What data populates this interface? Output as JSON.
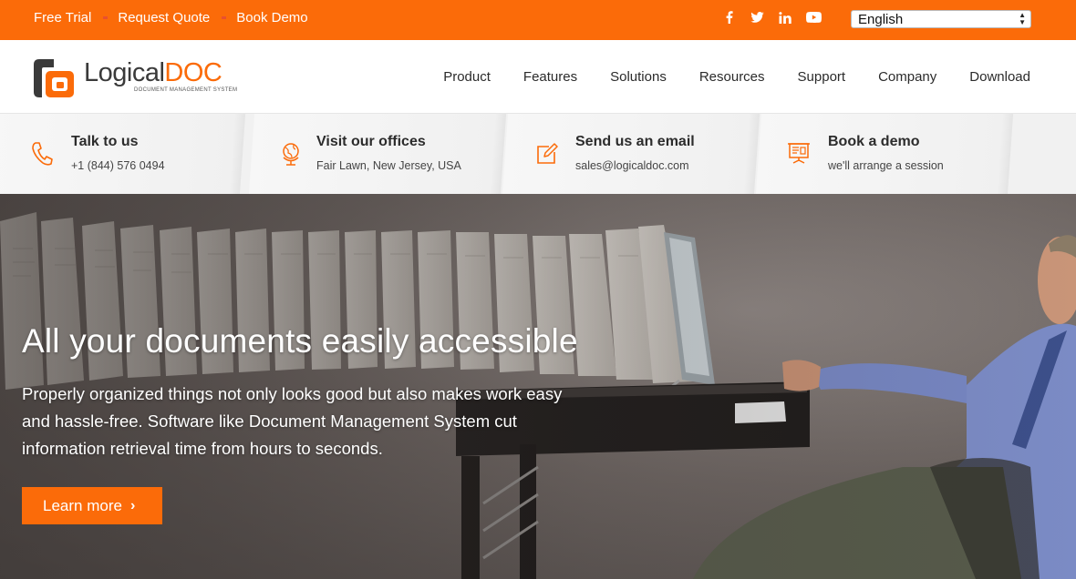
{
  "topbar": {
    "links": [
      "Free Trial",
      "Request Quote",
      "Book Demo"
    ],
    "social_icons": [
      "facebook-icon",
      "twitter-icon",
      "linkedin-icon",
      "youtube-icon"
    ],
    "language": "English"
  },
  "logo": {
    "name_part1": "Logical",
    "name_part2": "DOC",
    "tagline": "DOCUMENT MANAGEMENT SYSTEM"
  },
  "nav": {
    "items": [
      "Product",
      "Features",
      "Solutions",
      "Resources",
      "Support",
      "Company",
      "Download"
    ]
  },
  "contact": {
    "items": [
      {
        "title": "Talk to us",
        "sub": "+1 (844) 576 0494",
        "icon": "phone-icon"
      },
      {
        "title": "Visit our offices",
        "sub": "Fair Lawn, New Jersey, USA",
        "icon": "globe-icon"
      },
      {
        "title": "Send us an email",
        "sub": "sales@logicaldoc.com",
        "icon": "edit-icon"
      },
      {
        "title": "Book a demo",
        "sub": "we'll arrange a session",
        "icon": "presentation-icon"
      }
    ]
  },
  "hero": {
    "title": "All your documents easily accessible",
    "text": "Properly organized things not only looks good but also makes work easy and hassle-free. Software like Document Management System cut information retrieval time from hours to seconds.",
    "button": "Learn more"
  },
  "colors": {
    "accent": "#fb6b09",
    "topbar_bg": "#fb6b09",
    "contact_bg": "#f1f1f1"
  }
}
